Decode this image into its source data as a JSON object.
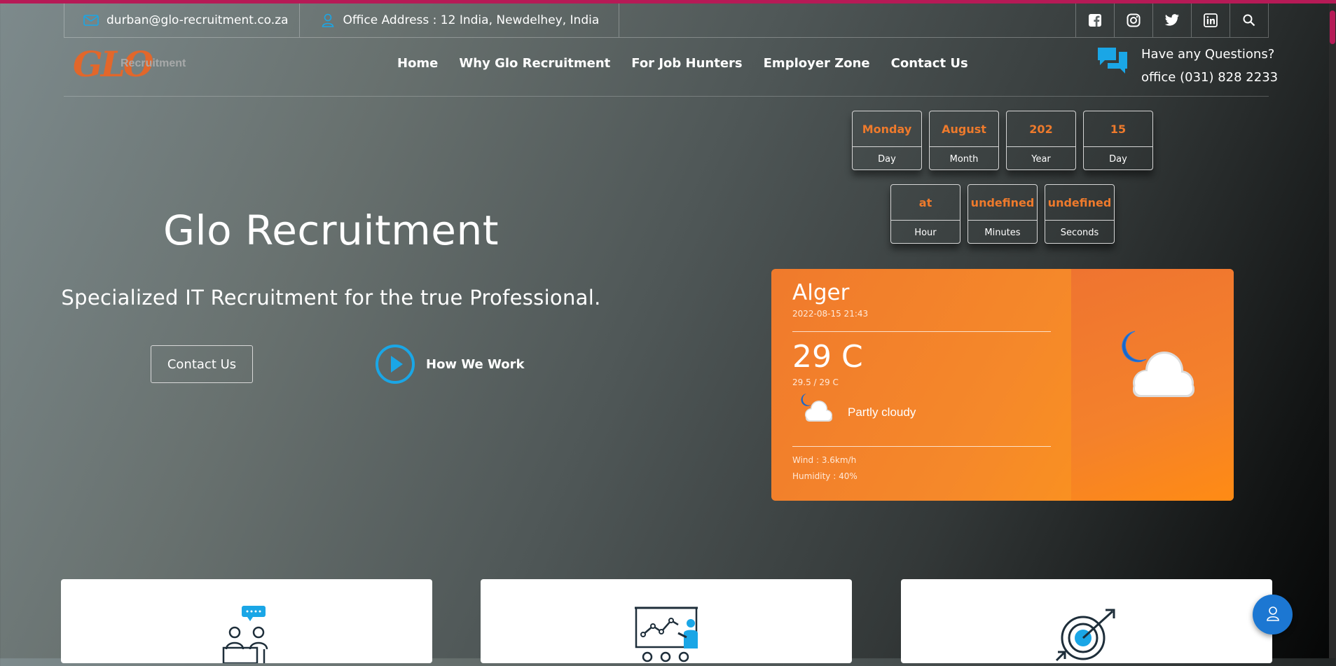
{
  "topbar": {
    "email": "durban@glo-recruitment.co.za",
    "address": "Office Address : 12 India, Newdelhey, India",
    "social_icons": [
      "facebook-icon",
      "instagram-icon",
      "twitter-icon",
      "linkedin-icon",
      "search-icon"
    ]
  },
  "logo": {
    "mark": "GLO",
    "text": "Recruitment"
  },
  "nav": {
    "items": [
      "Home",
      "Why Glo Recruitment",
      "For Job Hunters",
      "Employer Zone",
      "Contact Us"
    ]
  },
  "contact": {
    "question": "Have any Questions?",
    "phone": "office (031) 828 2233",
    "icon": "chat-icon"
  },
  "hero": {
    "title": "Glo Recruitment",
    "subtitle": "Specialized IT Recruitment for the true Professional.",
    "contact_button": "Contact Us",
    "how_button": "How We Work"
  },
  "clock": {
    "row1": [
      {
        "value": "Monday",
        "label": "Day"
      },
      {
        "value": "August",
        "label": "Month"
      },
      {
        "value": "202",
        "label": "Year"
      },
      {
        "value": "15",
        "label": "Day"
      }
    ],
    "row2": [
      {
        "value": "at",
        "label": "Hour"
      },
      {
        "value": "undefined",
        "label": "Minutes"
      },
      {
        "value": "undefined",
        "label": "Seconds"
      }
    ]
  },
  "weather": {
    "city": "Alger",
    "datetime": "2022-08-15 21:43",
    "temp": "29 C",
    "range": "29.5 / 29 C",
    "condition": "Partly cloudy",
    "wind": "Wind : 3.6km/h",
    "humidity": "Humidity : 40%"
  },
  "colors": {
    "accent_orange": "#ee7a2c",
    "accent_blue": "#1aa6e6",
    "top_line": "#b61a56",
    "fab_blue": "#1c77d2"
  }
}
